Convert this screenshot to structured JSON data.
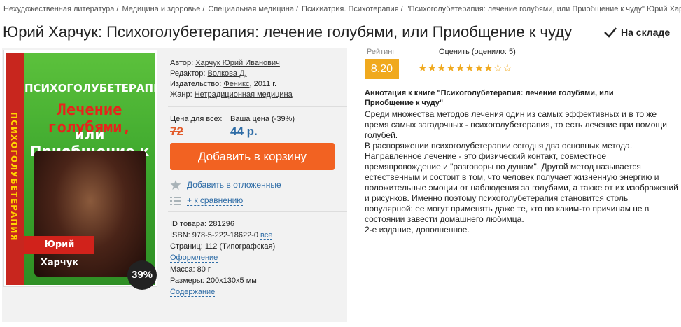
{
  "breadcrumb": [
    "Нехудожественная литература",
    "Медицина и здоровье",
    "Специальная медицина",
    "Психиатрия. Психотерапия",
    "\"Психоголубетерапия: лечение голубями, или Приобщение к чуду\" Юрий Харчук"
  ],
  "book": {
    "title": "Юрий Харчук: Психоголубетерапия: лечение голубями, или Приобщение к чуду",
    "stock": "На складе",
    "cover": {
      "spine_text": "ПСИХОГОЛУБЕТЕРАПИЯ",
      "line1": "ПСИХОГОЛУБЕТЕРАПИЯ",
      "line2": "Лечение голубями,",
      "line3": "или Приобщение к чуду",
      "author": "Юрий Харчук"
    },
    "discount_badge": "39%",
    "author_label": "Автор:",
    "author": "Харчук Юрий Иванович",
    "editor_label": "Редактор:",
    "editor": "Волкова Д.",
    "publisher_label": "Издательство:",
    "publisher": "Феникс",
    "publisher_year": ", 2011 г.",
    "genre_label": "Жанр:",
    "genre": "Нетрадиционная медицина"
  },
  "price": {
    "all_label": "Цена для всех",
    "your_label": "Ваша цена (-39%)",
    "old": "72",
    "new": "44 р."
  },
  "actions": {
    "add_to_cart": "Добавить в корзину",
    "defer": "Добавить в отложенные",
    "compare": "+ к сравнению"
  },
  "meta": {
    "id": "ID товара: 281296",
    "isbn": "ISBN: 978-5-222-18622-0",
    "isbn_all": "все",
    "pages": "Страниц: 112 (Типографская)",
    "design": "Оформление",
    "weight": "Масса: 80 г",
    "size": "Размеры: 200x130x5 мм",
    "contents": "Содержание"
  },
  "rating": {
    "label": "Рейтинг",
    "value": "8.20",
    "rate_label": "Оценить (оценило: 5)",
    "stars_total": 10,
    "stars_filled": 8.2
  },
  "annotation": {
    "title": "Аннотация к книге \"Психоголубетерапия: лечение голубями, или Приобщение к чуду\"",
    "p1": "Среди множества методов лечения один из самых эффективных и в то же время самых загадочных - психоголубетерапия, то есть лечение при помощи голубей.",
    "p2": "В распоряжении психоголубетерапии сегодня два основных метода. Направленное лечение - это физический контакт, совместное времяпровождение и \"разговоры по душам\". Другой метод называется естественным и состоит в том, что человек получает жизненную энергию и положительные эмоции от наблюдения за голубями, а также от их изображений и рисунков. Именно поэтому психоголубетерапия становится столь популярной: ее могут применять даже те, кто по каким-то причинам не в состоянии завести домашнего любимца.",
    "p3": "2-е издание, дополненное."
  },
  "colors": {
    "accent_orange": "#f26222",
    "rating_orange": "#f0a91e",
    "link_blue": "#2e6ca6",
    "old_price": "#e25b2a"
  }
}
